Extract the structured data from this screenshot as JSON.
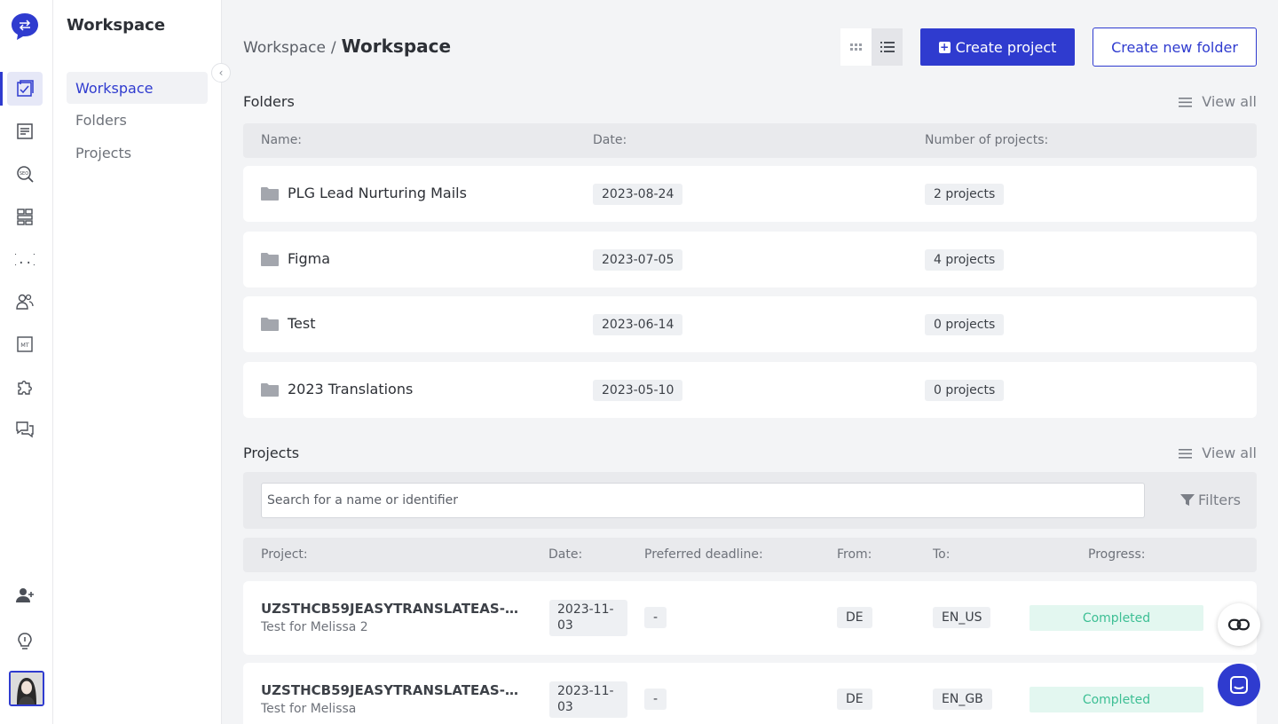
{
  "sidebar": {
    "title": "Workspace",
    "items": [
      {
        "label": "Workspace",
        "active": true
      },
      {
        "label": "Folders",
        "active": false
      },
      {
        "label": "Projects",
        "active": false
      }
    ]
  },
  "rail": {
    "icons": [
      "projects-icon",
      "document-icon",
      "seo-search-icon",
      "structure-icon",
      "code-braces-icon",
      "team-icon",
      "machine-translation-icon",
      "puzzle-icon",
      "chat-icon",
      "add-user-icon",
      "lightbulb-icon"
    ]
  },
  "breadcrumb": {
    "root": "Workspace",
    "separator": "/",
    "current": "Workspace"
  },
  "toolbar": {
    "create_project_label": "Create project",
    "create_folder_label": "Create new folder"
  },
  "folders": {
    "title": "Folders",
    "view_all": "View all",
    "columns": [
      "Name:",
      "Date:",
      "Number of projects:"
    ],
    "rows": [
      {
        "name": "PLG Lead Nurturing Mails",
        "date": "2023-08-24",
        "count": "2 projects"
      },
      {
        "name": "Figma",
        "date": "2023-07-05",
        "count": "4 projects"
      },
      {
        "name": "Test",
        "date": "2023-06-14",
        "count": "0 projects"
      },
      {
        "name": "2023 Translations",
        "date": "2023-05-10",
        "count": "0 projects"
      }
    ]
  },
  "projects": {
    "title": "Projects",
    "view_all": "View all",
    "search_placeholder": "Search for a name or identifier",
    "filters_label": "Filters",
    "columns": [
      "Project:",
      "Date:",
      "Preferred deadline:",
      "From:",
      "To:",
      "Progress:"
    ],
    "rows": [
      {
        "id": "UZSTHCB59JEASYTRANSLATEAS-P...",
        "name": "Test for Melissa 2",
        "date": "2023-11-03",
        "deadline": "-",
        "from": "DE",
        "to": "EN_US",
        "progress": "Completed"
      },
      {
        "id": "UZSTHCB59JEASYTRANSLATEAS-P...",
        "name": "Test for Melissa",
        "date": "2023-11-03",
        "deadline": "-",
        "from": "DE",
        "to": "EN_GB",
        "progress": "Completed"
      }
    ]
  },
  "colors": {
    "accent": "#2f3bcf",
    "completed_bg": "#e3f7f0",
    "completed_text": "#3dbf94"
  }
}
